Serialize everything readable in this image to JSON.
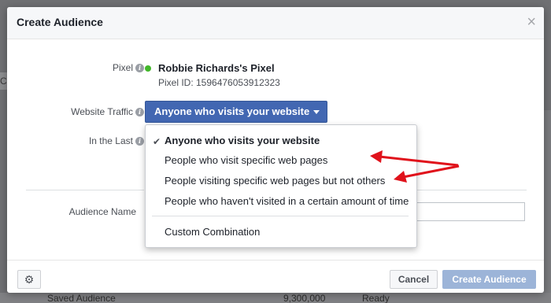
{
  "dialog": {
    "title": "Create Audience",
    "close_icon": "×"
  },
  "pixel": {
    "label": "Pixel",
    "name": "Robbie Richards's Pixel",
    "id_text": "Pixel ID: 1596476053912323",
    "status_color": "#42b72a"
  },
  "website_traffic": {
    "label": "Website Traffic",
    "selected": "Anyone who visits your website"
  },
  "in_the_last": {
    "label": "In the Last"
  },
  "audience_name": {
    "label": "Audience Name",
    "value": ""
  },
  "dropdown": {
    "options": [
      {
        "label": "Anyone who visits your website",
        "selected": true
      },
      {
        "label": "People who visit specific web pages",
        "selected": false
      },
      {
        "label": "People visiting specific web pages but not others",
        "selected": false
      },
      {
        "label": "People who haven't visited in a certain amount of time",
        "selected": false
      },
      {
        "label": "Custom Combination",
        "selected": false
      }
    ],
    "check_glyph": "✔"
  },
  "footer": {
    "settings_icon": "gear-icon",
    "cancel_label": "Cancel",
    "create_label": "Create Audience"
  },
  "background": {
    "left_fragment": "Co",
    "bottom_left": "Saved Audience",
    "bottom_mid": "9,300,000",
    "bottom_right": "Ready"
  },
  "colors": {
    "primary": "#4267b2",
    "create_disabled": "#9cb4d8",
    "annotation_arrow": "#e0121b"
  }
}
